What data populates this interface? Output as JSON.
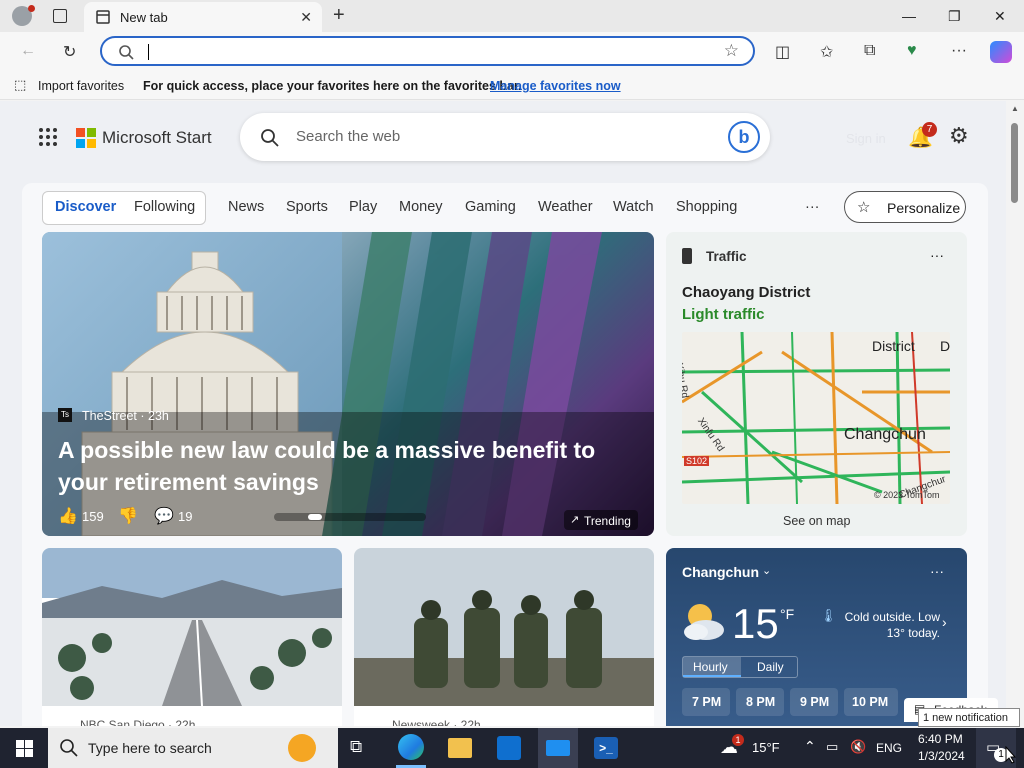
{
  "window": {
    "tab_title": "New tab"
  },
  "address": {
    "value": ""
  },
  "favbar": {
    "import": "Import favorites",
    "message": "For quick access, place your favorites here on the favorites bar.",
    "link": "Manage favorites now"
  },
  "header": {
    "brand": "Microsoft Start",
    "search_placeholder": "Search the web",
    "sign_in": "Sign in",
    "notif_count": "7"
  },
  "nav": {
    "items": [
      "Discover",
      "Following",
      "News",
      "Sports",
      "Play",
      "Money",
      "Gaming",
      "Weather",
      "Watch",
      "Shopping"
    ],
    "more": "···",
    "personalize": "Personalize"
  },
  "hero": {
    "source": "TheStreet · 23h",
    "headline": "A possible new law could be a massive benefit to your retirement savings",
    "likes": "159",
    "comments": "19",
    "trending": "Trending"
  },
  "traffic": {
    "label": "Traffic",
    "menu": "···",
    "district": "Chaoyang District",
    "status": "Light traffic",
    "map_district": "District",
    "map_d": "D",
    "map_city": "Changchun",
    "map_road1": "Xihu Rd",
    "map_road2": "Xinfu Rd",
    "map_shield": "S102",
    "map_changchur": "Changchur",
    "attribution": "© 2023 TomTom",
    "see_map": "See on map"
  },
  "cards": [
    {
      "source": "NBC San Diego · 22h"
    },
    {
      "source": "Newsweek · 22h"
    }
  ],
  "weather": {
    "city": "Changchun",
    "menu": "···",
    "temp": "15",
    "unit": "°F",
    "note": "Cold outside. Low 13° today.",
    "tabs": [
      "Hourly",
      "Daily"
    ],
    "hours": [
      "7 PM",
      "8 PM",
      "9 PM",
      "10 PM"
    ],
    "feedback": "Feedback"
  },
  "taskbar": {
    "search_placeholder": "Type here to search",
    "weather_temp": "15°F",
    "weather_badge": "1",
    "lang": "ENG",
    "time": "6:40 PM",
    "date": "1/3/2024",
    "notification_count": "1",
    "tooltip": "1 new notification"
  },
  "colors": {
    "accent": "#2a65c8",
    "traffic_status": "#2a8a2a",
    "taskbar": "#1f2330"
  }
}
